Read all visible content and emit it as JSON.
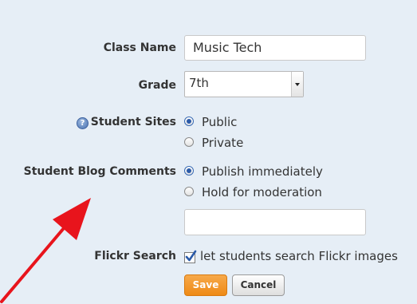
{
  "form": {
    "class_name": {
      "label": "Class Name",
      "value": "Music Tech"
    },
    "grade": {
      "label": "Grade",
      "selected": "7th"
    },
    "student_sites": {
      "label": "Student Sites",
      "options": [
        "Public",
        "Private"
      ],
      "selected": "Public"
    },
    "blog_comments": {
      "label": "Student Blog Comments",
      "options": [
        "Publish immediately",
        "Hold for moderation"
      ],
      "selected": "Publish immediately"
    },
    "extra_field": {
      "value": ""
    },
    "flickr": {
      "label": "Flickr Search",
      "checkbox_label": "let students search Flickr images",
      "checked": true
    },
    "buttons": {
      "save": "Save",
      "cancel": "Cancel"
    }
  },
  "colors": {
    "panel_bg": "#e6eef6",
    "save_button": "#ee8a16",
    "annotation_arrow": "#e8141c"
  },
  "icons": [
    "help-icon",
    "checkmark-icon",
    "annotation-arrow"
  ]
}
